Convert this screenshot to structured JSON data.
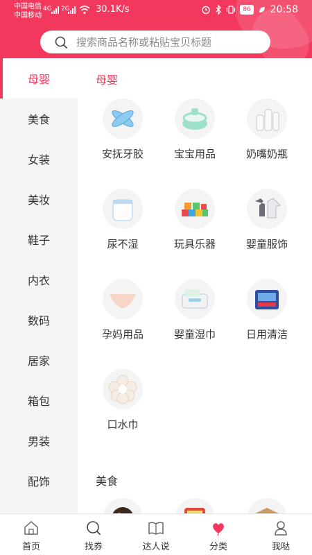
{
  "status_bar": {
    "carrier1": "中国电信",
    "carrier2": "中国移动",
    "net1": "4G",
    "net2": "2G",
    "speed": "30.1K/s",
    "battery": "86",
    "time": "20:58"
  },
  "search": {
    "placeholder": "搜索商品名称或粘贴宝贝标题"
  },
  "sidebar": {
    "items": [
      {
        "label": "母婴",
        "active": true
      },
      {
        "label": "美食"
      },
      {
        "label": "女装"
      },
      {
        "label": "美妆"
      },
      {
        "label": "鞋子"
      },
      {
        "label": "内衣"
      },
      {
        "label": "数码"
      },
      {
        "label": "居家"
      },
      {
        "label": "箱包"
      },
      {
        "label": "男装"
      },
      {
        "label": "配饰"
      }
    ]
  },
  "main": {
    "sections": [
      {
        "title": "母婴",
        "items": [
          {
            "label": "安抚牙胶",
            "icon": "teether-icon"
          },
          {
            "label": "宝宝用品",
            "icon": "potty-icon"
          },
          {
            "label": "奶嘴奶瓶",
            "icon": "bottle-icon"
          },
          {
            "label": "尿不湿",
            "icon": "diaper-icon"
          },
          {
            "label": "玩具乐器",
            "icon": "blocks-icon"
          },
          {
            "label": "婴童服饰",
            "icon": "onesie-icon"
          },
          {
            "label": "孕妈用品",
            "icon": "maternity-underwear-icon"
          },
          {
            "label": "婴童湿巾",
            "icon": "wipes-icon"
          },
          {
            "label": "日用清洁",
            "icon": "tissue-icon"
          },
          {
            "label": "口水巾",
            "icon": "bib-icon"
          }
        ]
      },
      {
        "title": "美食"
      }
    ]
  },
  "bottom_nav": {
    "items": [
      {
        "label": "首页",
        "icon": "home-icon"
      },
      {
        "label": "找券",
        "icon": "search-icon"
      },
      {
        "label": "达人说",
        "icon": "book-icon"
      },
      {
        "label": "分类",
        "icon": "heart-balloon-icon",
        "active": true
      },
      {
        "label": "我哒",
        "icon": "user-icon"
      }
    ]
  },
  "colors": {
    "accent": "#f3385d",
    "sidebar_bg": "#f5f5f5"
  }
}
